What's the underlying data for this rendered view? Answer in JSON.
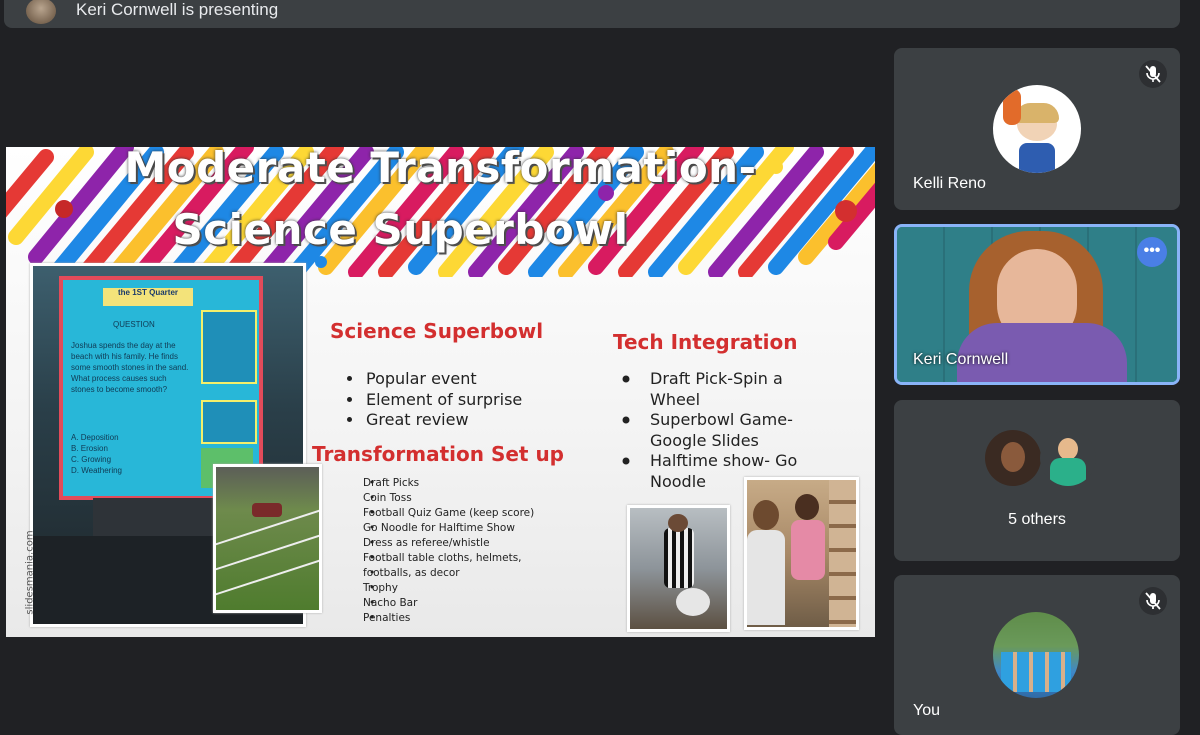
{
  "presenter_bar": {
    "label": "Keri Cornwell is presenting"
  },
  "slide": {
    "title_line1": "Moderate Transformation-",
    "title_line2": "Science Superbowl",
    "section1_heading": "Science Superbowl",
    "section1_items": [
      "Popular event",
      "Element of surprise",
      "Great review"
    ],
    "section2_heading": "Transformation Set up",
    "section2_items": [
      "Draft Picks",
      "Coin Toss",
      "Football Quiz Game (keep score)",
      "Go Noodle for Halftime Show",
      "Dress as referee/whistle",
      "Football table cloths, helmets,",
      "footballs, as decor",
      "Trophy",
      "Nacho Bar",
      "Penalties"
    ],
    "section3_heading": "Tech Integration",
    "section3_items": [
      "Draft Pick-Spin a",
      "Wheel",
      "Superbowl Game-",
      "Google Slides",
      "Halftime show- Go",
      "Noodle"
    ],
    "watermark": "slidesmania.com",
    "board_header": "the 1ST Quarter",
    "board_question_label": "QUESTION",
    "board_question": "Joshua spends the day at the beach with his family. He finds some smooth stones in the sand. What process causes such stones to become smooth?",
    "board_options": [
      "A. Deposition",
      "B. Erosion",
      "C. Growing",
      "D. Weathering"
    ]
  },
  "participants": [
    {
      "name": "Kelli Reno",
      "mic_muted": true
    },
    {
      "name": "Keri Cornwell",
      "active_speaker": true,
      "more_icon": "more-options-icon"
    },
    {
      "name": "5 others"
    },
    {
      "name": "You",
      "mic_muted": true
    }
  ],
  "colors": {
    "background": "#202124",
    "tile": "#3c4043",
    "active_border": "#8ab4f8",
    "heading_red": "#d32f2f"
  }
}
